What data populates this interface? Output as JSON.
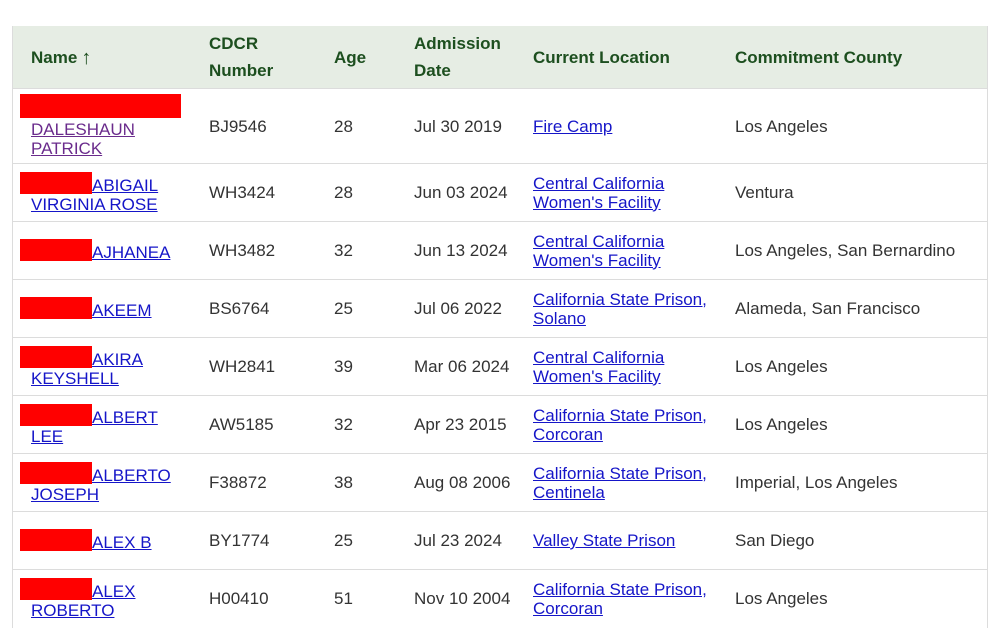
{
  "table": {
    "headers": {
      "name": "Name",
      "name_sort_icon": "arrow-up-icon",
      "name_sort_glyph": "↑",
      "cdcr": "CDCR Number",
      "age": "Age",
      "admission": "Admission Date",
      "location": "Current Location",
      "county": "Commitment County"
    },
    "rows": [
      {
        "name": "DALESHAUN PATRICK",
        "cdcr": "BJ9546",
        "age": "28",
        "admission": "Jul 30 2019",
        "location": "Fire Camp",
        "county": "Los Angeles"
      },
      {
        "name": "ABIGAIL VIRGINIA ROSE",
        "cdcr": "WH3424",
        "age": "28",
        "admission": "Jun 03 2024",
        "location": "Central California Women's Facility",
        "county": "Ventura"
      },
      {
        "name": "AJHANEA",
        "cdcr": "WH3482",
        "age": "32",
        "admission": "Jun 13 2024",
        "location": "Central California Women's Facility",
        "county": "Los Angeles, San Bernardino"
      },
      {
        "name": "AKEEM",
        "cdcr": "BS6764",
        "age": "25",
        "admission": "Jul 06 2022",
        "location": "California State Prison, Solano",
        "county": "Alameda, San Francisco"
      },
      {
        "name": "AKIRA KEYSHELL",
        "cdcr": "WH2841",
        "age": "39",
        "admission": "Mar 06 2024",
        "location": "Central California Women's Facility",
        "county": "Los Angeles"
      },
      {
        "name": "ALBERT LEE",
        "cdcr": "AW5185",
        "age": "32",
        "admission": "Apr 23 2015",
        "location": "California State Prison, Corcoran",
        "county": "Los Angeles"
      },
      {
        "name": "ALBERTO JOSEPH",
        "cdcr": "F38872",
        "age": "38",
        "admission": "Aug 08 2006",
        "location": "California State Prison, Centinela",
        "county": "Imperial, Los Angeles"
      },
      {
        "name": "ALEX B",
        "cdcr": "BY1774",
        "age": "25",
        "admission": "Jul 23 2024",
        "location": "Valley State Prison",
        "county": "San Diego"
      },
      {
        "name": "ALEX ROBERTO",
        "cdcr": "H00410",
        "age": "51",
        "admission": "Nov 10 2004",
        "location": "California State Prison, Corcoran",
        "county": "Los Angeles"
      }
    ]
  },
  "colors": {
    "header_bg": "#e6ede4",
    "header_text": "#1d4f1f",
    "link": "#1515c8",
    "visited_link": "#6a2b8c",
    "redaction": "#ff0000"
  }
}
